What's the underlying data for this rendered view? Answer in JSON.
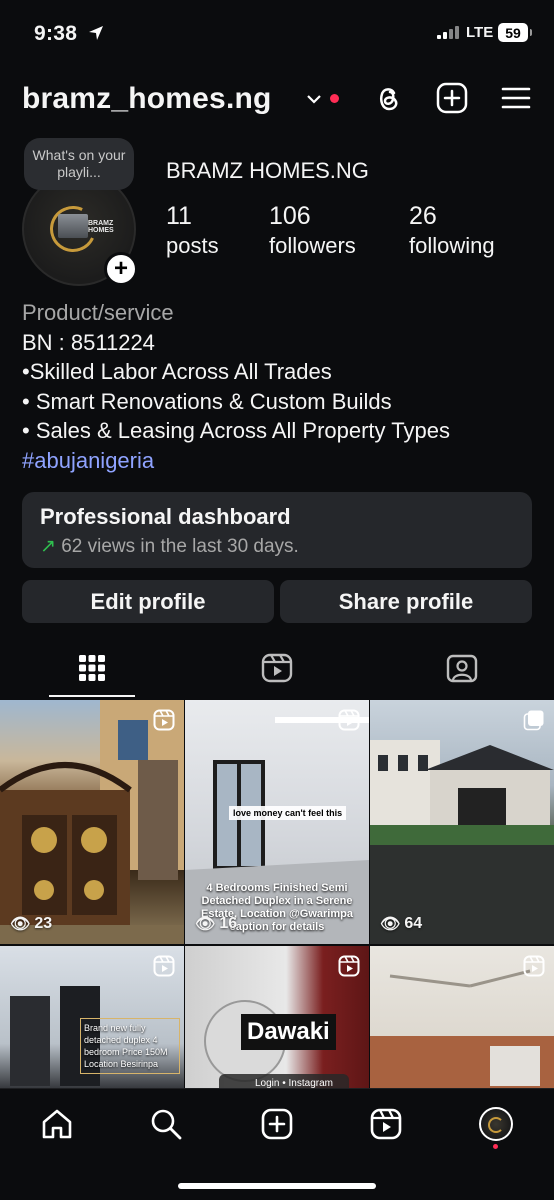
{
  "status": {
    "time": "9:38",
    "network": "LTE",
    "battery": "59"
  },
  "header": {
    "username": "bramz_homes.ng"
  },
  "profile": {
    "note": "What's on your playli...",
    "display_name": "BRAMZ HOMES.NG",
    "avatar_text": "BRAMZ HOMES",
    "stats": [
      {
        "value": "11",
        "label": "posts"
      },
      {
        "value": "106",
        "label": "followers"
      },
      {
        "value": "26",
        "label": "following"
      }
    ],
    "bio": {
      "category": "Product/service",
      "lines": [
        "BN : 8511224",
        "•Skilled Labor Across All Trades",
        "• Smart Renovations & Custom Builds",
        "• Sales & Leasing Across All Property Types"
      ],
      "hashtag": "#abujanigeria"
    }
  },
  "dashboard": {
    "title": "Professional dashboard",
    "arrow": "↗",
    "subtitle": "62 views in the last 30 days."
  },
  "actions": {
    "edit": "Edit profile",
    "share": "Share profile"
  },
  "grid": [
    {
      "views": "23"
    },
    {
      "views": "16",
      "caption": "love money can't feel this",
      "overlay": "4 Bedrooms Finished Semi Detached Duplex in a Serene Estate, Location @Gwarimpa caption for details"
    },
    {
      "views": "64"
    },
    {
      "overlay": "Brand new fully detached duplex 4 bedroom Price 150M Location Besirinpa"
    },
    {
      "overlay": "Dawaki",
      "sub": "Login • Instagram"
    },
    {}
  ],
  "colors": {
    "background": "#0b0c0e",
    "card": "#25272b",
    "link": "#8fa3ff",
    "accent_red": "#ff2d55"
  }
}
